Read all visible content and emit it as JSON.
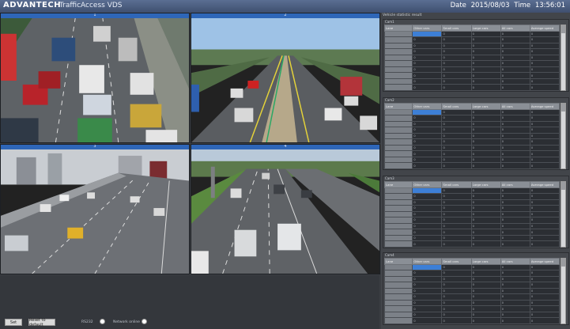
{
  "header": {
    "logo": "ADVANTECH",
    "app_title": "TrafficAccess VDS",
    "date_label": "Date",
    "date_value": "2015/08/03",
    "time_label": "Time",
    "time_value": "13:56:01"
  },
  "cameras": [
    {
      "label": "1"
    },
    {
      "label": "2"
    },
    {
      "label": "3"
    },
    {
      "label": "4"
    }
  ],
  "footer": {
    "btn_set": "Set",
    "btn_reset": "Reset to default",
    "opt_rs232": "RS232",
    "opt_network": "Network online"
  },
  "stats": {
    "title": "Vehicle statistic result",
    "columns": [
      "Lane",
      "Other cars",
      "Small cars",
      "Large cars",
      "All cars",
      "Average speed"
    ],
    "rows": [
      [
        "",
        "",
        "0",
        "0",
        "0",
        "0"
      ],
      [
        "",
        "0",
        "0",
        "0",
        "0",
        "0"
      ],
      [
        "",
        "0",
        "0",
        "0",
        "0",
        "0"
      ],
      [
        "",
        "0",
        "0",
        "0",
        "0",
        "0"
      ],
      [
        "",
        "0",
        "0",
        "0",
        "0",
        "0"
      ],
      [
        "",
        "0",
        "0",
        "0",
        "0",
        "0"
      ],
      [
        "",
        "0",
        "0",
        "0",
        "0",
        "0"
      ],
      [
        "",
        "0",
        "0",
        "0",
        "0",
        "0"
      ],
      [
        "",
        "0",
        "0",
        "0",
        "0",
        "0"
      ],
      [
        "",
        "0",
        "0",
        "0",
        "0",
        "0"
      ]
    ],
    "blocks": [
      {
        "label": "Cam1"
      },
      {
        "label": "Cam2"
      },
      {
        "label": "Cam3"
      },
      {
        "label": "Cam4"
      }
    ]
  },
  "colors": {
    "accent": "#2e66b8",
    "highlight": "#3d7fd6",
    "header_top": "#5a6e92",
    "panel_bg": "#3b3e43"
  }
}
